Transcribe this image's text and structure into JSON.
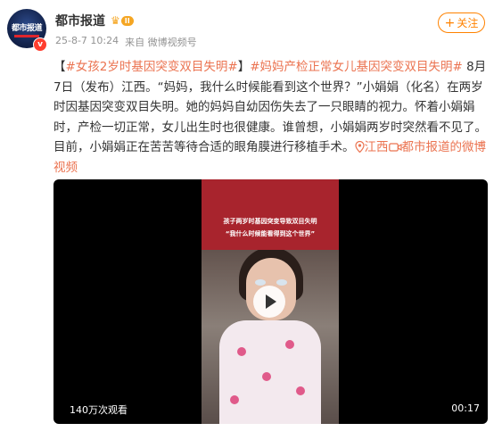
{
  "author": {
    "name": "都市报道",
    "vip_level": "II",
    "verified": "v",
    "avatar_text": "都市报道"
  },
  "meta": {
    "time": "25-8-7 10:24",
    "source": "来自 微博视频号"
  },
  "follow_label": "关注",
  "follow_plus": "+",
  "post": {
    "bracket_open": "【",
    "tag1": "#女孩2岁时基因突变双目失明#",
    "bracket_close": "】",
    "tag2": "#妈妈产检正常女儿基因突变双目失明#",
    "body": " 8月7日（发布）江西。“妈妈，我什么时候能看到这个世界？”小娟娟（化名）在两岁时因基因突变双目失明。她的妈妈自幼因伤失去了一只眼睛的视力。怀着小娟娟时，产检一切正常，女儿出生时也很健康。谁曾想，小娟娟两岁时突然看不见了。目前，小娟娟正在苦苦等待合适的眼角膜进行移植手术。",
    "location": "江西",
    "video_link": "都市报道的微博视频"
  },
  "video": {
    "banner_line1": "孩子两岁时基因突变导致双目失明",
    "banner_line2": "“我什么时候能看得到这个世界”",
    "views": "140万次观看",
    "duration": "00:17"
  },
  "colors": {
    "accent": "#ff8200",
    "topic": "#eb7350",
    "banner": "#a8242d"
  }
}
